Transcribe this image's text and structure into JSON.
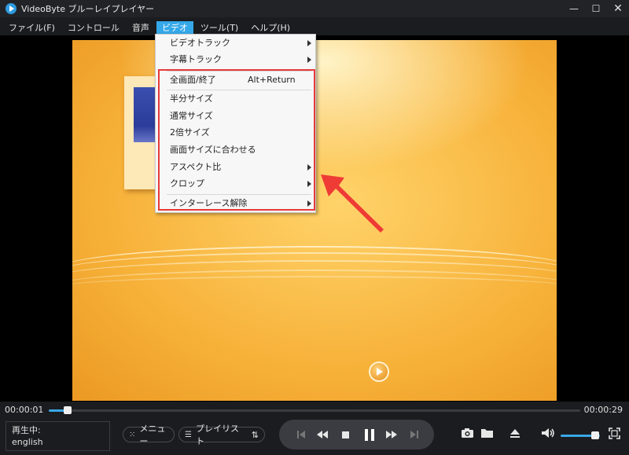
{
  "window": {
    "title": "VideoByte ブルーレイプレイヤー",
    "logo_icon": "play-circle-icon",
    "minimize": "—",
    "maximize": "☐",
    "close": "✕"
  },
  "menubar": {
    "items": [
      {
        "label": "ファイル(F)",
        "active": false
      },
      {
        "label": "コントロール",
        "active": false
      },
      {
        "label": "音声",
        "active": false
      },
      {
        "label": "ビデオ",
        "active": true
      },
      {
        "label": "ツール(T)",
        "active": false
      },
      {
        "label": "ヘルプ(H)",
        "active": false
      }
    ]
  },
  "video_menu": {
    "items": [
      {
        "label": "ビデオトラック",
        "submenu": true
      },
      {
        "label": "字幕トラック",
        "submenu": true
      },
      {
        "label": "全画面/終了",
        "shortcut": "Alt+Return"
      },
      {
        "label": "半分サイズ"
      },
      {
        "label": "通常サイズ"
      },
      {
        "label": "2倍サイズ"
      },
      {
        "label": "画面サイズに合わせる"
      },
      {
        "label": "アスペクト比",
        "submenu": true
      },
      {
        "label": "クロップ",
        "submenu": true
      },
      {
        "label": "インターレース解除",
        "submenu": true
      }
    ],
    "highlight_color": "#e63a3a"
  },
  "playback": {
    "current_time": "00:00:01",
    "total_time": "00:00:29",
    "progress": 0.035,
    "accent": "#3aa7e8"
  },
  "status": {
    "state": "再生中:",
    "audio": "english"
  },
  "buttons": {
    "menu_label": "メニュー",
    "playlist_label": "プレイリスト"
  },
  "volume": {
    "level": 0.88
  },
  "colors": {
    "menu_active": "#35a8e9",
    "video_bg": "#f5b23e",
    "annotation": "#e63a3a"
  }
}
